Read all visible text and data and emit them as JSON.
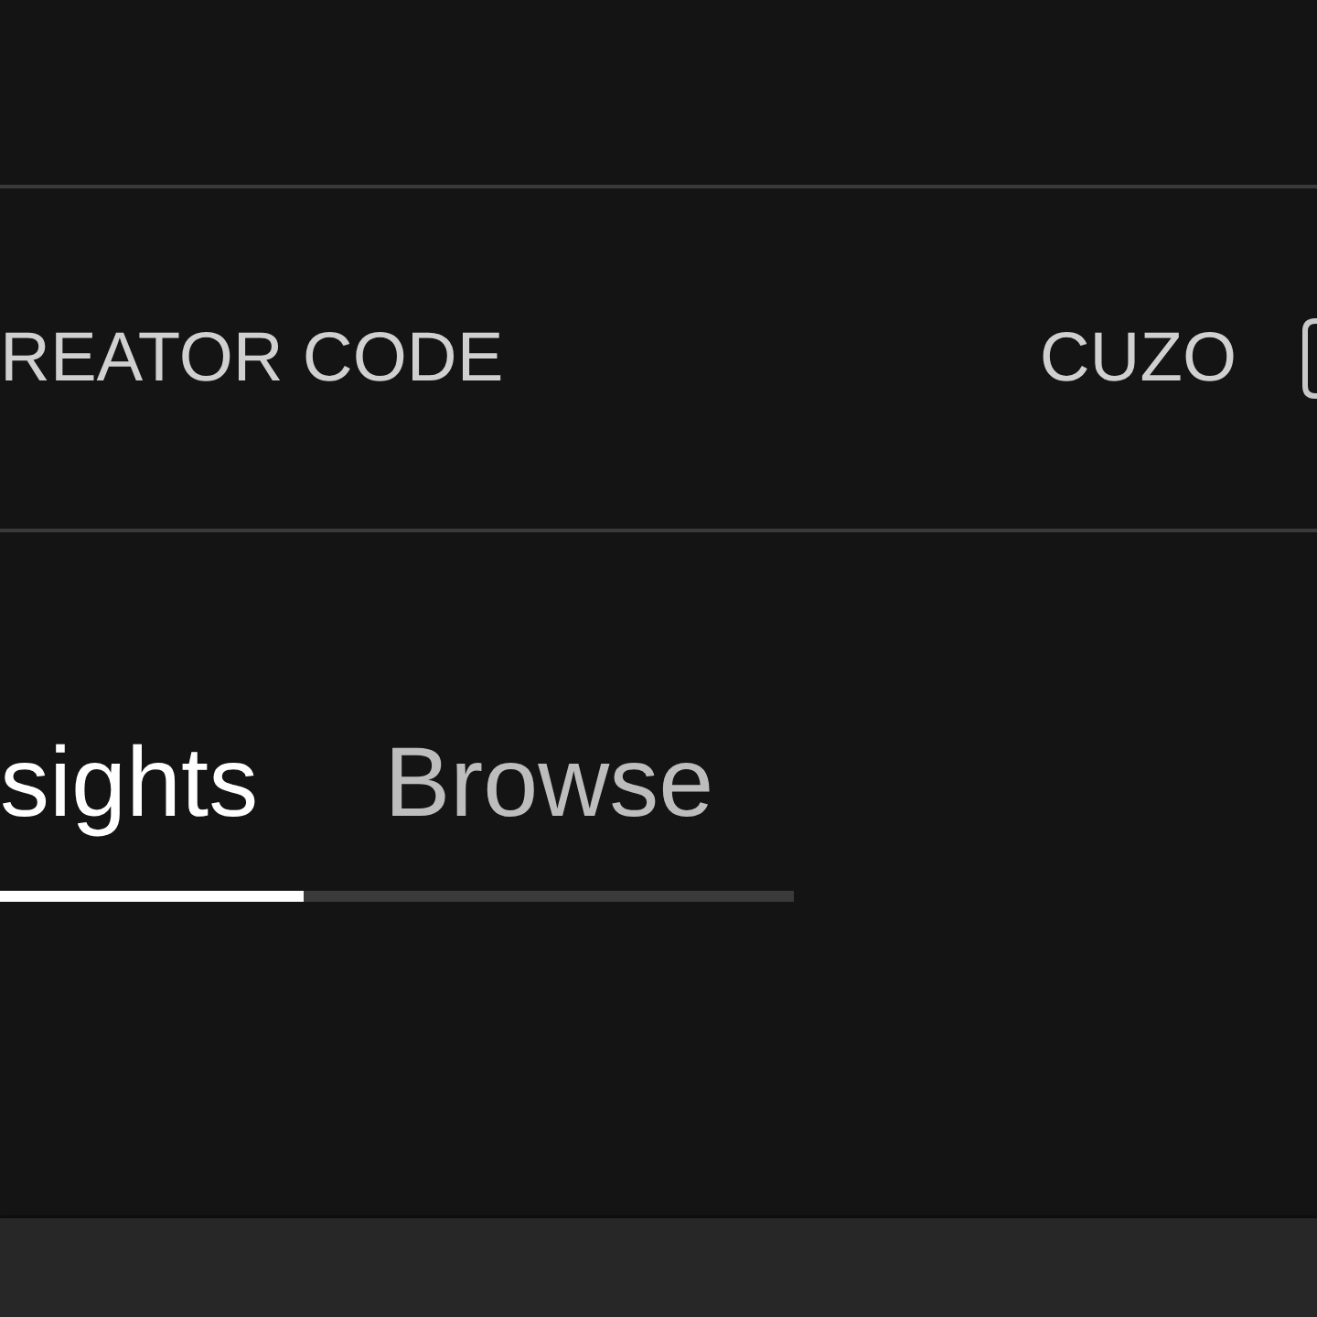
{
  "creator_code": {
    "label": "REATOR CODE",
    "value": "CUZO"
  },
  "tabs": [
    {
      "label": "sights",
      "selected": true
    },
    {
      "label": "Browse",
      "selected": false
    }
  ]
}
